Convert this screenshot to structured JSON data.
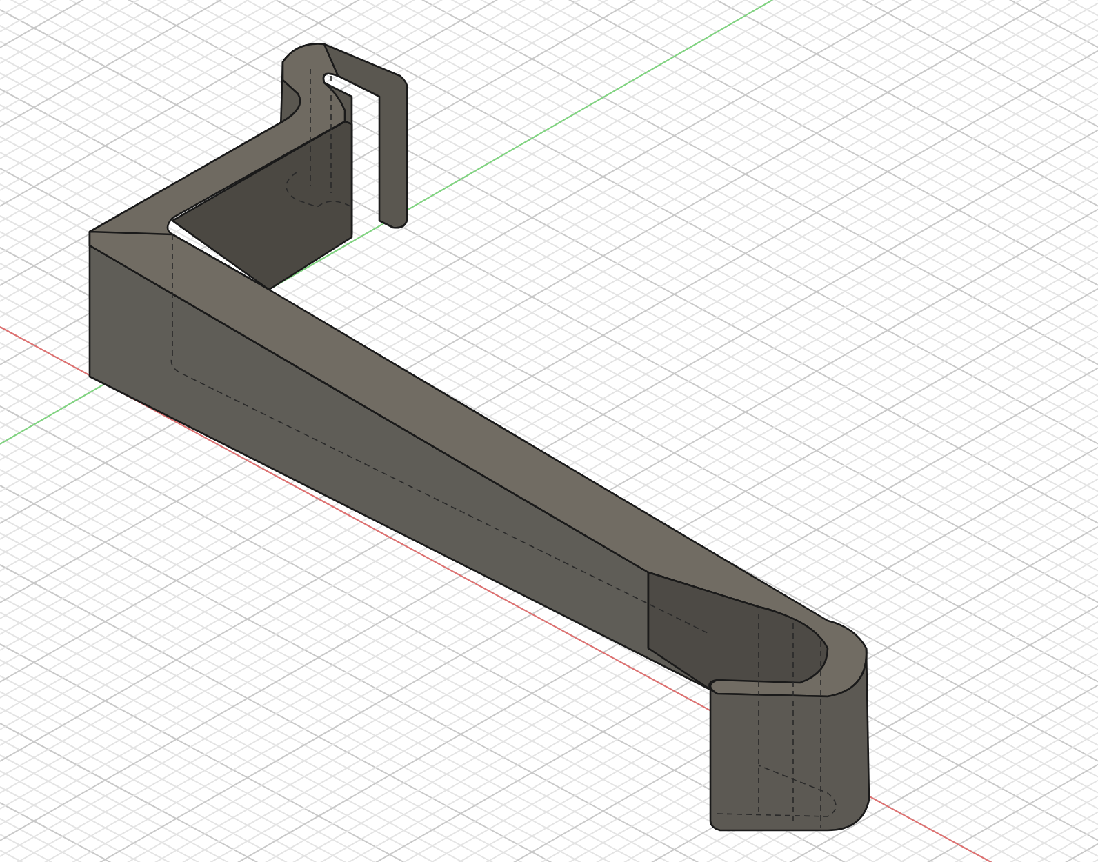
{
  "viewport": {
    "show_grid": true,
    "show_axes": true,
    "show_hidden_edges": true
  }
}
